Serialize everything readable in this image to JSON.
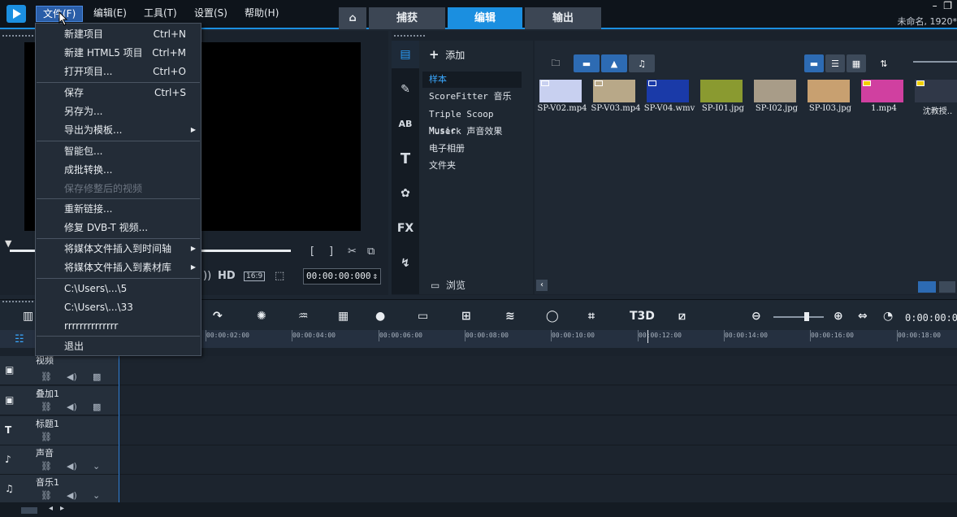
{
  "menubar": {
    "items": [
      {
        "label": "文件(F)",
        "active": true
      },
      {
        "label": "编辑(E)"
      },
      {
        "label": "工具(T)"
      },
      {
        "label": "设置(S)"
      },
      {
        "label": "帮助(H)"
      }
    ]
  },
  "workspace_tabs": [
    {
      "label": "捕获"
    },
    {
      "label": "编辑",
      "active": true
    },
    {
      "label": "输出"
    }
  ],
  "project_title": "未命名, 1920*",
  "file_menu": {
    "items": [
      {
        "label": "新建项目",
        "shortcut": "Ctrl+N"
      },
      {
        "label": "新建 HTML5 项目",
        "shortcut": "Ctrl+M"
      },
      {
        "label": "打开项目...",
        "shortcut": "Ctrl+O"
      },
      {
        "label": "保存",
        "shortcut": "Ctrl+S"
      },
      {
        "label": "另存为..."
      },
      {
        "label": "导出为模板...",
        "submenu": true
      },
      {
        "label": "智能包..."
      },
      {
        "label": "成批转换..."
      },
      {
        "label": "保存修整后的视频",
        "disabled": true
      },
      {
        "label": "重新链接..."
      },
      {
        "label": "修复 DVB-T 视频..."
      },
      {
        "label": "将媒体文件插入到时间轴",
        "submenu": true
      },
      {
        "label": "将媒体文件插入到素材库",
        "submenu": true
      },
      {
        "label": "C:\\Users\\...\\5"
      },
      {
        "label": "C:\\Users\\...\\33"
      },
      {
        "label": "rrrrrrrrrrrrrr"
      },
      {
        "label": "退出"
      }
    ]
  },
  "preview": {
    "timecode": "00:00:00:000",
    "hd_label": "HD",
    "aspect": "16:9"
  },
  "library": {
    "add_label": "添加",
    "folders": [
      {
        "label": "样本",
        "active": true
      },
      {
        "label": "ScoreFitter 音乐"
      },
      {
        "label": "Triple Scoop Music"
      },
      {
        "label": "Muserk 声音效果"
      },
      {
        "label": "电子相册"
      },
      {
        "label": "文件夹"
      }
    ],
    "browse_label": "浏览",
    "sidebar_icons": [
      "media-icon",
      "instant-project-icon",
      "transition-icon",
      "title-icon",
      "graphics-icon",
      "filter-icon",
      "path-icon"
    ],
    "fx_label": "FX",
    "thumbs": [
      {
        "label": "SP-V02.mp4",
        "color": "#c8d0f0"
      },
      {
        "label": "SP-V03.mp4",
        "color": "#b8a888"
      },
      {
        "label": "SP-V04.wmv",
        "color": "#1a3aa8"
      },
      {
        "label": "SP-I01.jpg",
        "color": "#8a9a30"
      },
      {
        "label": "SP-I02.jpg",
        "color": "#a89c88"
      },
      {
        "label": "SP-I03.jpg",
        "color": "#c8a070"
      },
      {
        "label": "1.mp4",
        "color": "#d040a0"
      },
      {
        "label": "沈教授..",
        "color": "#303848"
      }
    ]
  },
  "timeline": {
    "time_readout": "0:00:00:0",
    "ruler_ticks": [
      "00:00:02:00",
      "00:00:04:00",
      "00:00:06:00",
      "00:00:08:00",
      "00:00:10:00",
      "00:00:12:00",
      "00:00:14:00",
      "00:00:16:00",
      "00:00:18:00"
    ],
    "tracks": [
      {
        "label": "视频",
        "icon": "video-track-icon"
      },
      {
        "label": "叠加1",
        "icon": "overlay-track-icon"
      },
      {
        "label": "标题1",
        "icon": "title-track-icon"
      },
      {
        "label": "声音",
        "icon": "voice-track-icon"
      },
      {
        "label": "音乐1",
        "icon": "music-track-icon"
      }
    ]
  },
  "colors": {
    "accent": "#1b8fe0",
    "menu_bg": "#232c37",
    "panel_bg": "#1a222c"
  }
}
